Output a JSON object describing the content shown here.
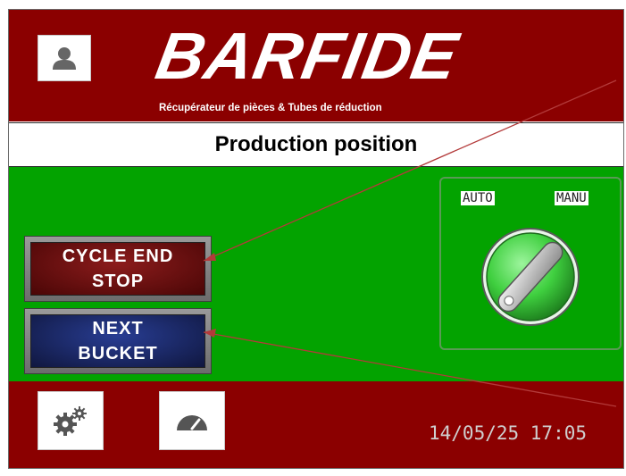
{
  "header": {
    "brand": "BARFIDE",
    "tagline": "Récupérateur de pièces & Tubes de réduction",
    "user_icon": "user-icon"
  },
  "title": "Production position",
  "buttons": {
    "cycle_end_stop": {
      "line1": "CYCLE END",
      "line2": "STOP",
      "color": "#5c0a0a"
    },
    "next_bucket": {
      "line1": "NEXT",
      "line2": "BUCKET",
      "color": "#1a2660"
    }
  },
  "selector_switch": {
    "left_label": "AUTO",
    "right_label": "MANU",
    "position": "AUTO",
    "color": "#3fcf3f"
  },
  "footer": {
    "settings_icon": "gears-icon",
    "dashboard_icon": "speedometer-icon",
    "datetime": "14/05/25 17:05"
  },
  "colors": {
    "brand_red": "#8b0000",
    "panel_green": "#03a300",
    "annotation_line": "#b33a3a"
  }
}
